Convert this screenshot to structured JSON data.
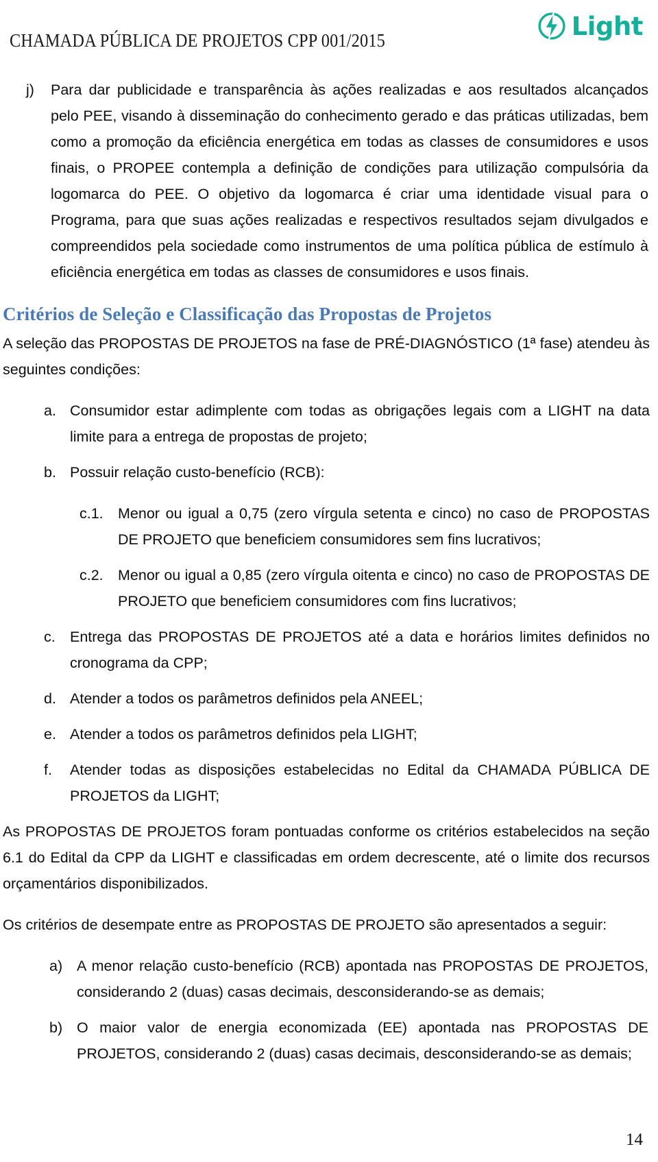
{
  "header": {
    "title": "CHAMADA PÚBLICA DE PROJETOS CPP 001/2015",
    "logo_word": "Light",
    "logo_color": "#16b09a"
  },
  "body": {
    "item_j": {
      "marker": "j)",
      "text": "Para dar publicidade e transparência às ações realizadas e aos resultados alcançados pelo PEE, visando à disseminação do conhecimento gerado e das práticas utilizadas, bem como a promoção da eficiência energética em todas as classes de consumidores e usos finais, o PROPEE contempla a definição de condições para utilização compulsória da logomarca do PEE. O objetivo da logomarca é criar uma identidade visual para o Programa, para que suas ações realizadas e respectivos resultados sejam divulgados e compreendidos pela sociedade como instrumentos de uma política pública de estímulo à eficiência energética em todas as classes de consumidores e usos finais."
    },
    "section_heading": "Critérios de Seleção e Classificação das Propostas de Projetos",
    "heading_color": "#4a7ab5",
    "intro_paragraph": "A seleção das PROPOSTAS DE PROJETOS na fase de PRÉ-DIAGNÓSTICO (1ª fase) atendeu às seguintes condições:",
    "conditions": [
      {
        "marker": "a.",
        "text": "Consumidor estar adimplente com todas as obrigações legais com a LIGHT na data limite para a entrega de propostas de projeto;"
      },
      {
        "marker": "b.",
        "text": "Possuir relação custo-benefício (RCB):"
      }
    ],
    "rcb_subitems": [
      {
        "marker": "c.1.",
        "text": "Menor ou igual a 0,75 (zero vírgula setenta e cinco) no caso de PROPOSTAS DE PROJETO que beneficiem consumidores sem fins lucrativos;"
      },
      {
        "marker": "c.2.",
        "text": "Menor ou igual a 0,85 (zero vírgula oitenta e cinco) no caso de PROPOSTAS DE PROJETO que beneficiem consumidores com fins lucrativos;"
      }
    ],
    "conditions_rest": [
      {
        "marker": "c.",
        "text": "Entrega das PROPOSTAS DE PROJETOS até a data e horários limites definidos no cronograma da CPP;"
      },
      {
        "marker": "d.",
        "text": "Atender a todos os parâmetros definidos pela ANEEL;"
      },
      {
        "marker": "e.",
        "text": "Atender a todos os parâmetros definidos pela LIGHT;"
      },
      {
        "marker": "f.",
        "text": "Atender todas as disposições estabelecidas no Edital da CHAMADA PÚBLICA DE PROJETOS da LIGHT;"
      }
    ],
    "scoring_paragraph": "As PROPOSTAS DE PROJETOS foram pontuadas conforme os critérios estabelecidos na seção 6.1 do Edital da CPP da LIGHT e classificadas em ordem decrescente, até o limite dos recursos orçamentários disponibilizados.",
    "tiebreak_intro": "Os critérios de desempate entre as PROPOSTAS DE PROJETO são apresentados a seguir:",
    "tiebreak_items": [
      {
        "marker": "a)",
        "text": "A menor relação custo-benefício (RCB) apontada nas PROPOSTAS DE PROJETOS, considerando 2 (duas) casas decimais, desconsiderando-se as demais;"
      },
      {
        "marker": "b)",
        "text": "O maior valor de energia economizada (EE) apontada nas PROPOSTAS DE PROJETOS, considerando 2 (duas) casas decimais, desconsiderando-se as demais;"
      }
    ]
  },
  "footer": {
    "page_number": "14"
  }
}
